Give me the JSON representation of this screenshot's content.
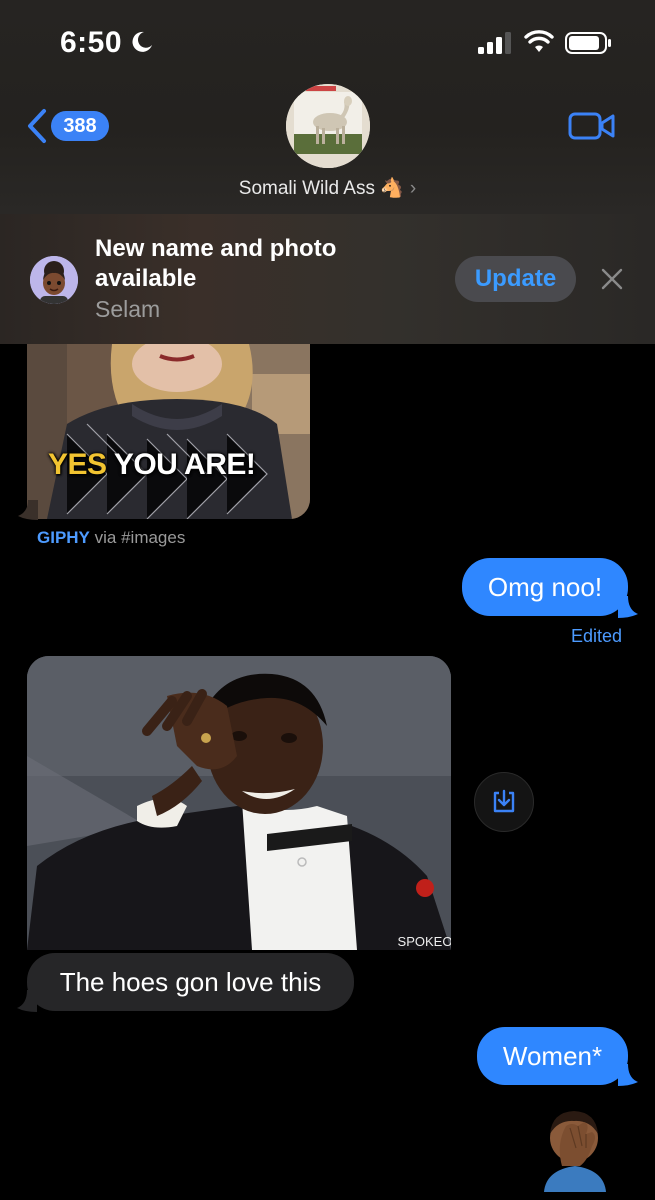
{
  "status_bar": {
    "time": "6:50"
  },
  "header": {
    "back_count": "388",
    "contact_name": "Somali Wild Ass 🐴",
    "chevron": "›"
  },
  "banner": {
    "title": "New name and photo available",
    "subtitle": "Selam",
    "update_label": "Update"
  },
  "messages": {
    "gif": {
      "caption_yes": "YES",
      "caption_rest": " YOU ARE!",
      "source_brand": "GIPHY",
      "source_rest": " via #images"
    },
    "outgoing_1": {
      "text": "Omg noo!",
      "status": "Edited"
    },
    "photo_watermark": "SPOKEO",
    "incoming_1": {
      "text": "The hoes gon love this"
    },
    "outgoing_2": {
      "text": "Women*"
    },
    "outgoing_3": {
      "emoji": "🤦🏾‍♂️"
    }
  },
  "colors": {
    "accent_blue": "#2f87ff",
    "incoming_gray": "#262628",
    "gif_yellow": "#f2c431"
  },
  "icons": [
    "moon-icon",
    "signal-icon",
    "wifi-icon",
    "battery-icon",
    "back-chevron-icon",
    "video-call-icon",
    "close-icon",
    "save-download-icon"
  ]
}
